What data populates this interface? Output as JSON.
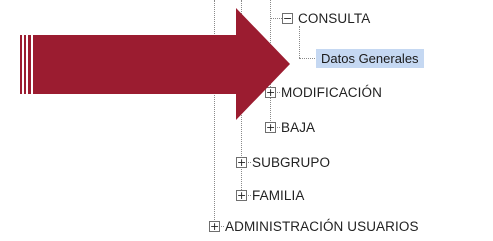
{
  "tree": {
    "nodes": [
      {
        "id": "consulta",
        "toggle": "−",
        "label": "CONSULTA"
      },
      {
        "id": "datos-generales",
        "toggle": "",
        "label": "Datos Generales",
        "selected": true
      },
      {
        "id": "modificacion",
        "toggle": "+",
        "label": "MODIFICACIÓN"
      },
      {
        "id": "baja",
        "toggle": "+",
        "label": "BAJA"
      },
      {
        "id": "subgrupo",
        "toggle": "+",
        "label": "SUBGRUPO"
      },
      {
        "id": "familia",
        "toggle": "+",
        "label": "FAMILIA"
      },
      {
        "id": "administracion-usuarios",
        "toggle": "+",
        "label": "ADMINISTRACIÓN USUARIOS"
      }
    ]
  },
  "annotation": {
    "arrow_color": "#9b1c30",
    "arrow_icon": "right-pointing-arrow"
  },
  "colors": {
    "selection_bg": "#c5d8f2",
    "tree_line": "#8a8a8a"
  }
}
